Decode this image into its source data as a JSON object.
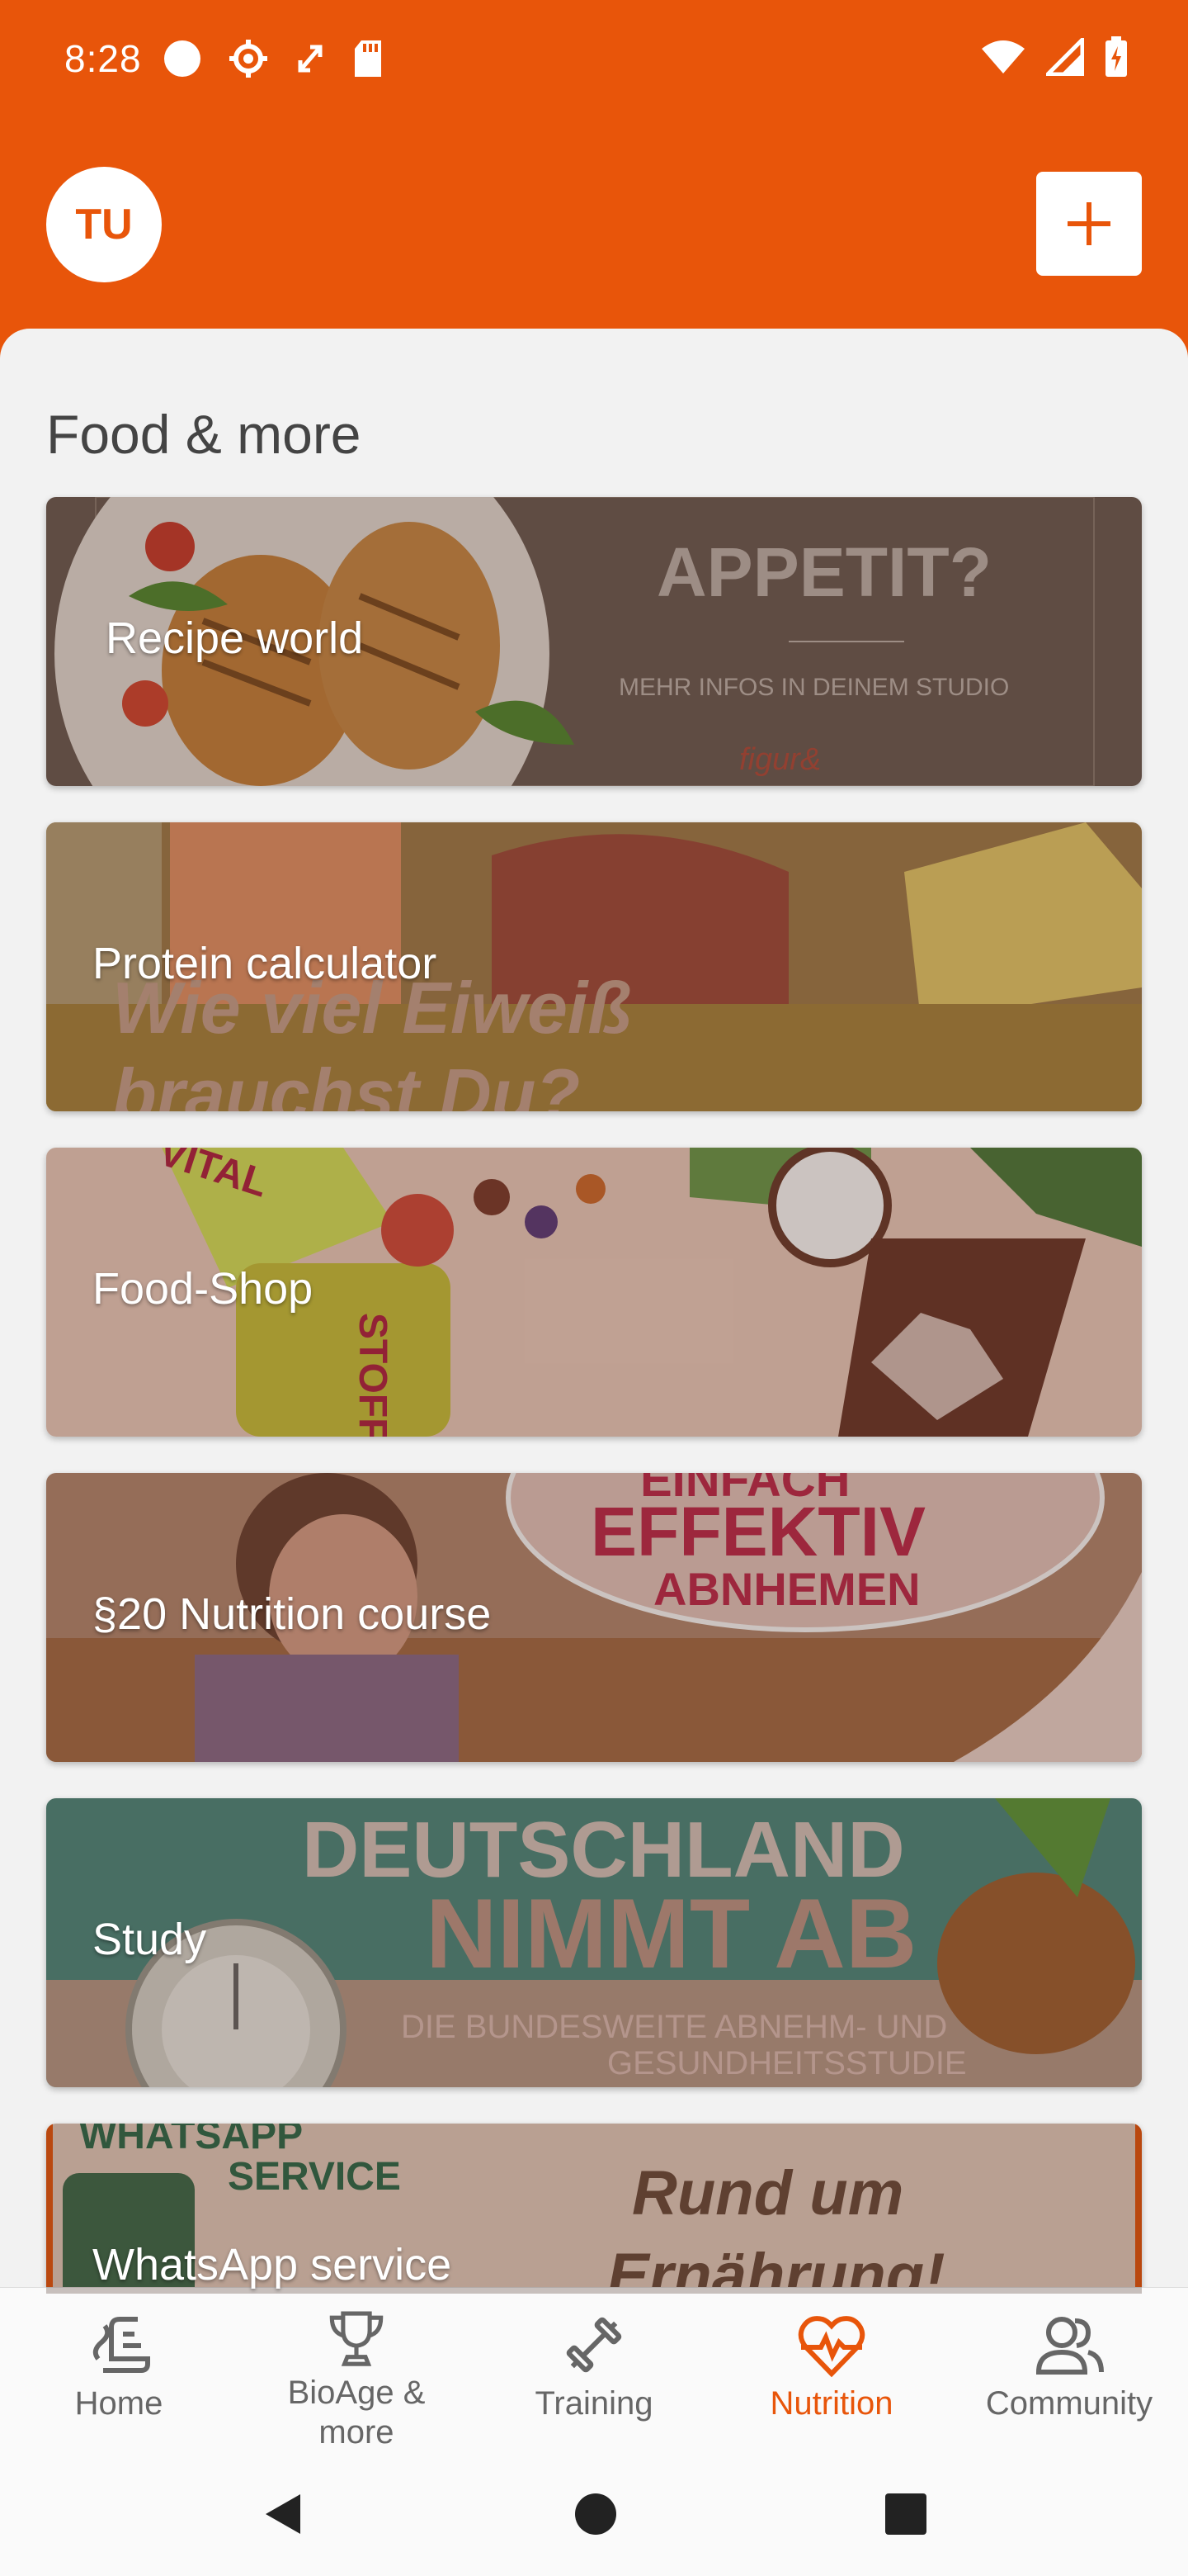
{
  "status_bar": {
    "time": "8:28"
  },
  "header": {
    "avatar_initials": "TU",
    "add_icon": "plus-icon"
  },
  "section": {
    "title": "Food & more"
  },
  "cards": [
    {
      "label": "Recipe world",
      "image_text": [
        "APPETIT?",
        "MEHR INFOS IN DEINEM STUDIO",
        "figur&"
      ]
    },
    {
      "label": "Protein calculator",
      "image_text": [
        "Wie viel Eiweiß",
        "brauchst Du?"
      ]
    },
    {
      "label": "Food-Shop",
      "image_text": [
        "VITAL",
        "STOFFE"
      ]
    },
    {
      "label": "§20 Nutrition course",
      "image_text": [
        "EINFACH",
        "EFFEKTIV",
        "ABNHEMEN"
      ]
    },
    {
      "label": "Study",
      "image_text": [
        "DEUTSCHLAND",
        "NIMMT AB",
        "DIE BUNDESWEITE ABNEHM- UND",
        "GESUNDHEITSSTUDIE"
      ]
    },
    {
      "label": "WhatsApp service",
      "image_text": [
        "WHATSAPP",
        "SERVICE",
        "Rund um",
        "Ernährung!"
      ]
    }
  ],
  "bottom_nav": [
    {
      "label": "Home",
      "icon": "home-icon"
    },
    {
      "label": "BioAge & more",
      "icon": "trophy-icon"
    },
    {
      "label": "Training",
      "icon": "dumbbell-icon"
    },
    {
      "label": "Nutrition",
      "icon": "nutrition-icon",
      "active": true
    },
    {
      "label": "Community",
      "icon": "community-icon"
    }
  ],
  "colors": {
    "brand": "#e8550a",
    "background": "#f2f2f2"
  }
}
